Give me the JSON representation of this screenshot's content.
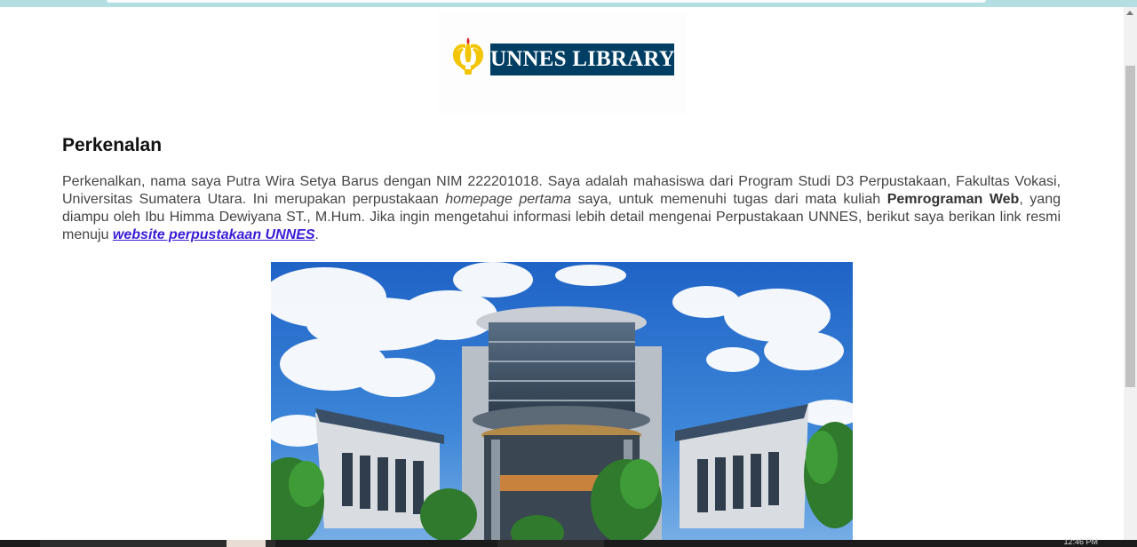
{
  "logo": {
    "text": "UNNES LIBRARY",
    "brand_color": "#003e63",
    "emblem_icon": "unnes-emblem-icon",
    "emblem_color": "#f2c500"
  },
  "content": {
    "title": "Perkenalan",
    "paragraph": {
      "p1": "Perkenalkan, nama saya Putra Wira Setya Barus dengan NIM 222201018. Saya adalah mahasiswa dari Program Studi D3 Perpustakaan, Fakultas Vokasi, Universitas Sumatera Utara. Ini merupakan perpustakaan ",
      "em": "homepage pertama",
      "p2": " saya, untuk memenuhi tugas dari mata kuliah ",
      "strong": "Pemrograman Web",
      "p3": ", yang diampu oleh Ibu Himma Dewiyana ST., M.Hum. Jika ingin mengetahui informasi lebih detail mengenai Perpustakaan UNNES, berikut saya berikan link resmi menuju ",
      "link": "website perpustakaan UNNES",
      "end": "."
    },
    "link_color": "#3a1cd6",
    "photo_icon": "library-building-photo"
  },
  "taskbar": {
    "clock": "12:46 PM"
  }
}
